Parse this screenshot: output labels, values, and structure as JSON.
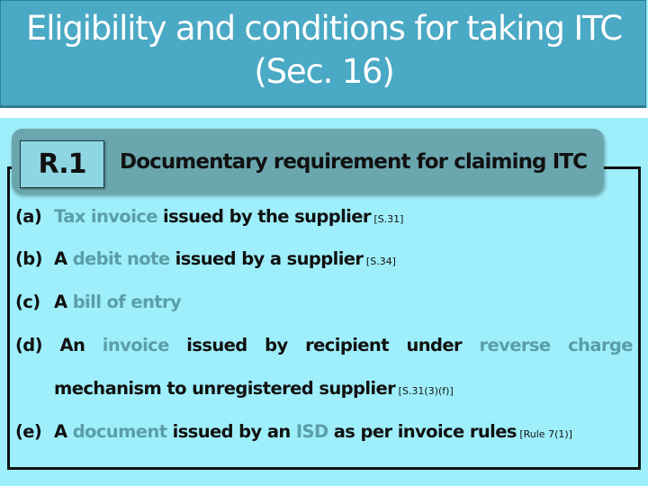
{
  "slide": {
    "title_line1": "Eligibility and conditions for taking ITC",
    "title_line2": "(Sec. 16)",
    "header": {
      "badge": "R.1",
      "title": "Documentary requirement for claiming ITC"
    },
    "colors": {
      "title_bar": "#4aa9c4",
      "content_bg": "#9eeffb",
      "header_box": "#6aa6ae",
      "badge_bg": "#8fd6e3",
      "highlight_text": "#5b9ea8"
    },
    "items": [
      {
        "label": "(a)",
        "pre": "",
        "hl1": "Tax invoice",
        "mid": " issued by the supplier",
        "hl2": "",
        "post": "",
        "ref": " [S.31]"
      },
      {
        "label": "(b)",
        "pre": "A ",
        "hl1": "debit note",
        "mid": " issued by a supplier",
        "hl2": "",
        "post": "",
        "ref": " [S.34]"
      },
      {
        "label": "(c)",
        "pre": "A ",
        "hl1": "bill of entry",
        "mid": "",
        "hl2": "",
        "post": "",
        "ref": ""
      },
      {
        "label": "(d)",
        "words": [
          "An",
          "invoice",
          "issued",
          "by",
          "recipient",
          "under",
          "reverse",
          "charge"
        ],
        "line2": "mechanism to unregistered supplier",
        "ref": " [S.31(3)(f)]"
      },
      {
        "label": "(e)",
        "pre": "A ",
        "hl1": "document",
        "mid": " issued by an ",
        "hl2": "ISD",
        "post": " as per invoice rules",
        "ref": " [Rule 7(1)]"
      }
    ]
  }
}
